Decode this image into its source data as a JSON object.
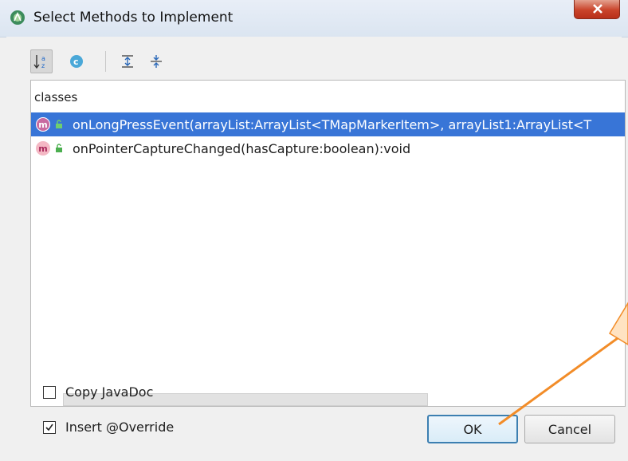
{
  "window": {
    "title": "Select Methods to Implement"
  },
  "toolbar": {
    "buttons": [
      {
        "name": "sort-alphabetically",
        "icon": "sort-az-icon",
        "pressed": true
      },
      {
        "name": "show-classes",
        "icon": "class-c-icon",
        "pressed": false
      },
      {
        "name": "expand-all",
        "icon": "expand-all-icon",
        "pressed": false
      },
      {
        "name": "collapse-all",
        "icon": "collapse-all-icon",
        "pressed": false
      }
    ]
  },
  "list": {
    "group_label": "classes",
    "items": [
      {
        "badge": "m",
        "signature": "onLongPressEvent(arrayList:ArrayList<TMapMarkerItem>, arrayList1:ArrayList<T",
        "selected": true
      },
      {
        "badge": "m",
        "signature": "onPointerCaptureChanged(hasCapture:boolean):void",
        "selected": false
      }
    ]
  },
  "options": {
    "copy_javadoc_label": "Copy JavaDoc",
    "copy_javadoc_checked": false,
    "insert_override_label": "Insert @Override",
    "insert_override_checked": true
  },
  "buttons": {
    "ok_label": "OK",
    "cancel_label": "Cancel"
  },
  "colors": {
    "selection": "#3875d7",
    "callout_arrow": "#f28c28"
  }
}
